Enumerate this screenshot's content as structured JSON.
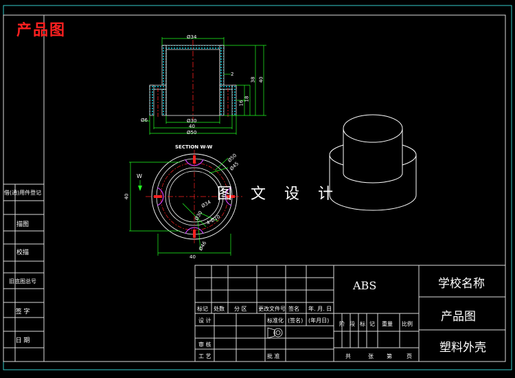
{
  "caption": "产品图",
  "watermark": "图 文 设 计",
  "section_label": "SECTION W-W",
  "section_mark": "W",
  "dims_front": {
    "d34": "Ø34",
    "t2": "2",
    "h38": "38",
    "h40": "40",
    "h16": "16",
    "h18": "18",
    "d6": "Ø6",
    "d30": "Ø30",
    "w40": "40",
    "d50": "Ø50"
  },
  "dims_section": {
    "d50": "Ø50",
    "d45": "Ø45",
    "h40": "40",
    "d34": "Ø34",
    "d30": "Ø30",
    "holes": "4-Ø10",
    "d46": "Ø46",
    "w40": "40"
  },
  "side_panel": [
    "借(通)用件登记",
    "描图",
    "校描",
    "旧底图总号",
    "签  字",
    "日  期"
  ],
  "title_block": {
    "material": "ABS",
    "school": "学校名称",
    "drawing_name": "产品图",
    "part_name": "塑料外壳",
    "row_headers": [
      "标记",
      "处数",
      "分 区",
      "更改文件号",
      "签名",
      "年. 月. 日"
    ],
    "design_label": "设  计",
    "standard_label": "标准化",
    "sign_label": "(签名)",
    "date_label": "(年月日)",
    "review_label": "审  核",
    "process_label": "工  艺",
    "approve_label": "批  准",
    "stage_headers": [
      "阶",
      "段",
      "标",
      "记",
      "重量",
      "比例"
    ],
    "sheet_footer": [
      "共",
      "张",
      "第",
      "页"
    ]
  }
}
